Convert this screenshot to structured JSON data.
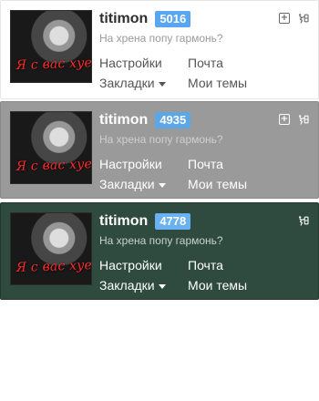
{
  "panels": [
    {
      "theme": "light",
      "user": {
        "name": "titimon",
        "count": "5016",
        "status": "На хрена попу гармонь?"
      },
      "avatar": {
        "caption": "Я с вас хуею"
      },
      "links": {
        "settings": "Настройки",
        "mail": "Почта",
        "bookmarks": "Закладки",
        "my_topics": "Мои темы"
      },
      "tools": {
        "show_add": true
      }
    },
    {
      "theme": "gray",
      "user": {
        "name": "titimon",
        "count": "4935",
        "status": "На хрена попу гармонь?"
      },
      "avatar": {
        "caption": "Я с вас хуею"
      },
      "links": {
        "settings": "Настройки",
        "mail": "Почта",
        "bookmarks": "Закладки",
        "my_topics": "Мои темы"
      },
      "tools": {
        "show_add": true
      }
    },
    {
      "theme": "dark-green",
      "user": {
        "name": "titimon",
        "count": "4778",
        "status": "На хрена попу гармонь?"
      },
      "avatar": {
        "caption": "Я с вас хуею"
      },
      "links": {
        "settings": "Настройки",
        "mail": "Почта",
        "bookmarks": "Закладки",
        "my_topics": "Мои темы"
      },
      "tools": {
        "show_add": false
      }
    }
  ],
  "icons": {
    "add": "add-icon",
    "logout": "logout-icon",
    "dropdown": "chevron-down-icon"
  },
  "colors": {
    "badge": "#59a6f0",
    "panel_gray": "#9a9a9a",
    "panel_dark_green": "#2f4a3f",
    "avatar_caption": "#ff2a2a"
  }
}
